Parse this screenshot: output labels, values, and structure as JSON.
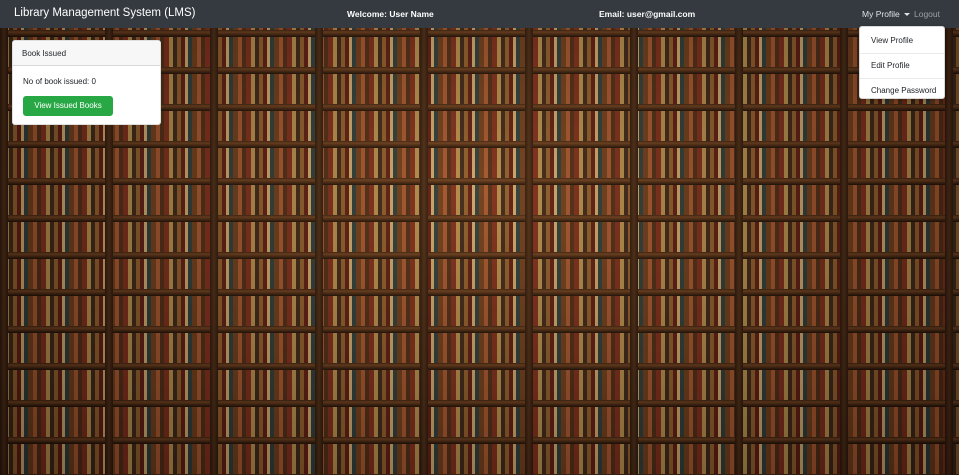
{
  "navbar": {
    "brand": "Library Management System (LMS)",
    "welcome": "Welcome: User Name",
    "email": "Email: user@gmail.com",
    "profile_label": "My Profile",
    "logout_label": "Logout"
  },
  "profile_menu": {
    "items": [
      "View Profile",
      "Edit Profile",
      "Change Password"
    ]
  },
  "card": {
    "header": "Book Issued",
    "text": "No of book issued: 0",
    "button_label": "View Issued Books"
  },
  "colors": {
    "navbar_bg": "#343a40",
    "success": "#28a745"
  }
}
